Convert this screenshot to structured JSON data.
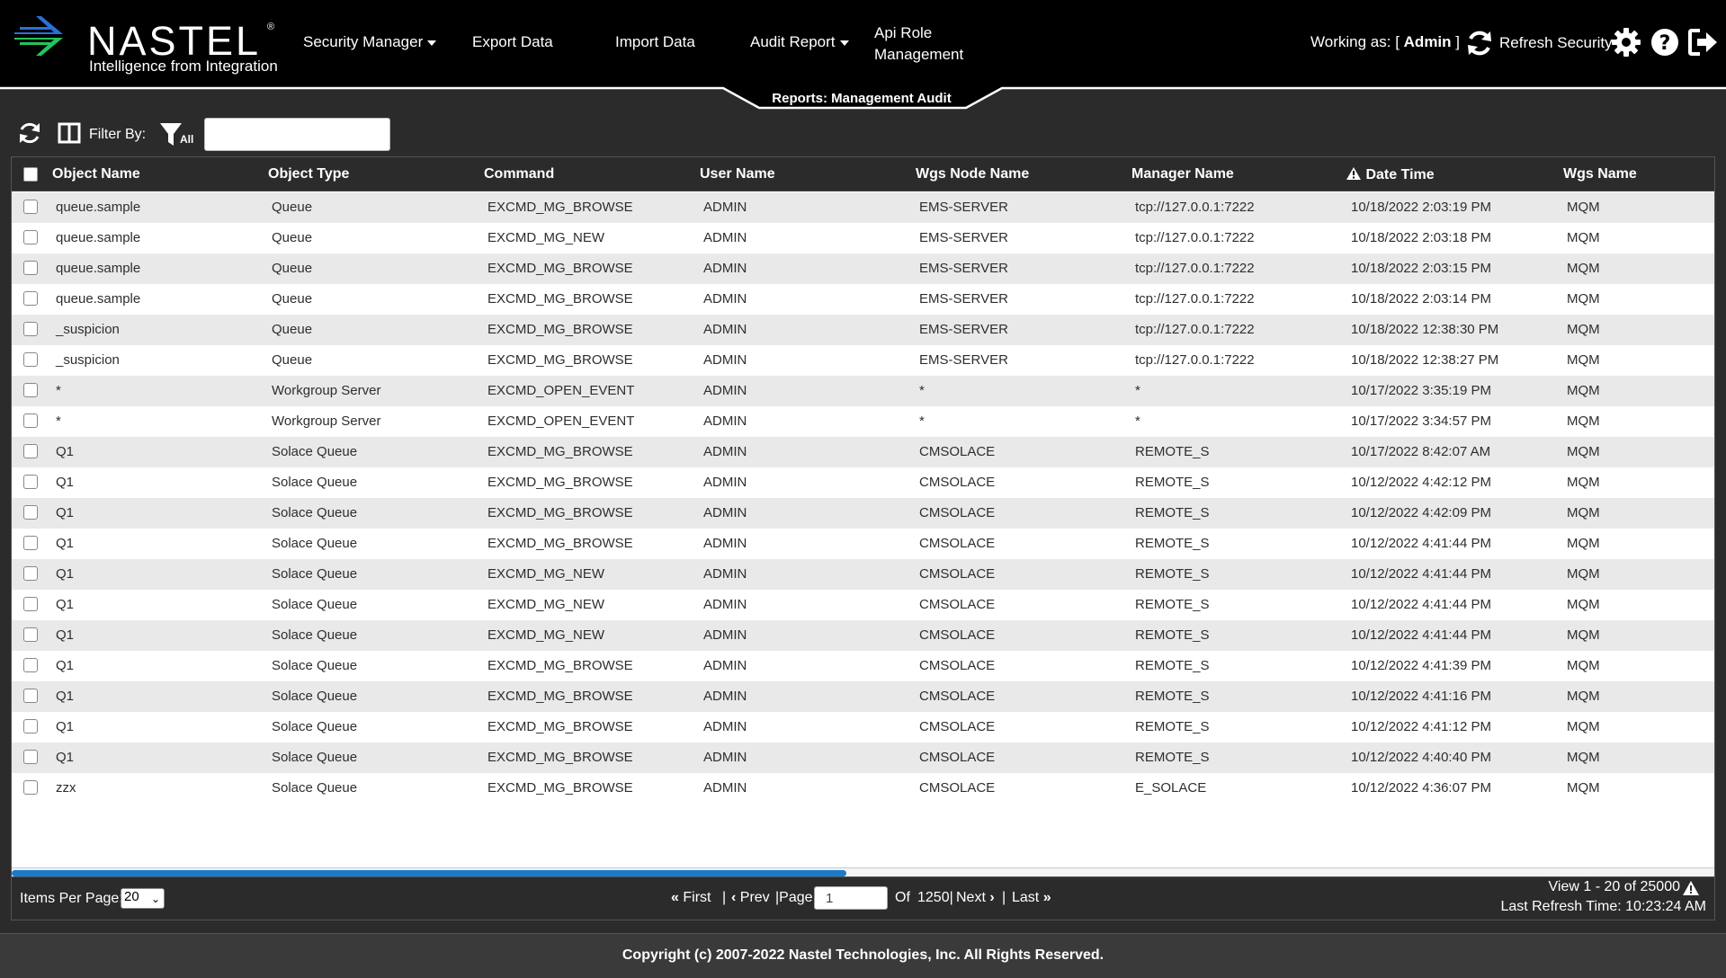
{
  "brand": {
    "logo_text": "NASTEL",
    "registered": "®",
    "tagline": "Intelligence from Integration"
  },
  "nav": {
    "security_manager": "Security Manager",
    "export_data": "Export Data",
    "import_data": "Import Data",
    "audit_report": "Audit Report",
    "api_role_line1": "Api Role",
    "api_role_line2": "Management"
  },
  "user": {
    "working_as_label": "Working as:",
    "bracket_open": "[",
    "name": "Admin",
    "bracket_close": "]",
    "refresh_security": "Refresh Security"
  },
  "icons": {
    "refresh": "refresh-icon",
    "settings": "gear-icon",
    "help": "help-icon",
    "logout": "logout-icon",
    "columns": "columns-icon",
    "filter": "filter-icon",
    "sort": "warning-triangle-icon"
  },
  "page": {
    "tab_title": "Reports: Management Audit"
  },
  "toolbar": {
    "filter_by_label": "Filter By:",
    "filter_all_label": "All",
    "filter_value": ""
  },
  "table": {
    "columns": [
      "Object Name",
      "Object Type",
      "Command",
      "User Name",
      "Wgs Node Name",
      "Manager Name",
      "Date Time",
      "Wgs Name"
    ],
    "rows": [
      [
        "queue.sample",
        "Queue",
        "EXCMD_MG_BROWSE",
        "ADMIN",
        "EMS-SERVER",
        "tcp://127.0.0.1:7222",
        "10/18/2022 2:03:19 PM",
        "MQM"
      ],
      [
        "queue.sample",
        "Queue",
        "EXCMD_MG_NEW",
        "ADMIN",
        "EMS-SERVER",
        "tcp://127.0.0.1:7222",
        "10/18/2022 2:03:18 PM",
        "MQM"
      ],
      [
        "queue.sample",
        "Queue",
        "EXCMD_MG_BROWSE",
        "ADMIN",
        "EMS-SERVER",
        "tcp://127.0.0.1:7222",
        "10/18/2022 2:03:15 PM",
        "MQM"
      ],
      [
        "queue.sample",
        "Queue",
        "EXCMD_MG_BROWSE",
        "ADMIN",
        "EMS-SERVER",
        "tcp://127.0.0.1:7222",
        "10/18/2022 2:03:14 PM",
        "MQM"
      ],
      [
        "_suspicion",
        "Queue",
        "EXCMD_MG_BROWSE",
        "ADMIN",
        "EMS-SERVER",
        "tcp://127.0.0.1:7222",
        "10/18/2022 12:38:30 PM",
        "MQM"
      ],
      [
        "_suspicion",
        "Queue",
        "EXCMD_MG_BROWSE",
        "ADMIN",
        "EMS-SERVER",
        "tcp://127.0.0.1:7222",
        "10/18/2022 12:38:27 PM",
        "MQM"
      ],
      [
        "*",
        "Workgroup Server",
        "EXCMD_OPEN_EVENT",
        "ADMIN",
        "*",
        "*",
        "10/17/2022 3:35:19 PM",
        "MQM"
      ],
      [
        "*",
        "Workgroup Server",
        "EXCMD_OPEN_EVENT",
        "ADMIN",
        "*",
        "*",
        "10/17/2022 3:34:57 PM",
        "MQM"
      ],
      [
        "Q1",
        "Solace Queue",
        "EXCMD_MG_BROWSE",
        "ADMIN",
        "CMSOLACE",
        "REMOTE_S",
        "10/17/2022 8:42:07 AM",
        "MQM"
      ],
      [
        "Q1",
        "Solace Queue",
        "EXCMD_MG_BROWSE",
        "ADMIN",
        "CMSOLACE",
        "REMOTE_S",
        "10/12/2022 4:42:12 PM",
        "MQM"
      ],
      [
        "Q1",
        "Solace Queue",
        "EXCMD_MG_BROWSE",
        "ADMIN",
        "CMSOLACE",
        "REMOTE_S",
        "10/12/2022 4:42:09 PM",
        "MQM"
      ],
      [
        "Q1",
        "Solace Queue",
        "EXCMD_MG_BROWSE",
        "ADMIN",
        "CMSOLACE",
        "REMOTE_S",
        "10/12/2022 4:41:44 PM",
        "MQM"
      ],
      [
        "Q1",
        "Solace Queue",
        "EXCMD_MG_NEW",
        "ADMIN",
        "CMSOLACE",
        "REMOTE_S",
        "10/12/2022 4:41:44 PM",
        "MQM"
      ],
      [
        "Q1",
        "Solace Queue",
        "EXCMD_MG_NEW",
        "ADMIN",
        "CMSOLACE",
        "REMOTE_S",
        "10/12/2022 4:41:44 PM",
        "MQM"
      ],
      [
        "Q1",
        "Solace Queue",
        "EXCMD_MG_NEW",
        "ADMIN",
        "CMSOLACE",
        "REMOTE_S",
        "10/12/2022 4:41:44 PM",
        "MQM"
      ],
      [
        "Q1",
        "Solace Queue",
        "EXCMD_MG_BROWSE",
        "ADMIN",
        "CMSOLACE",
        "REMOTE_S",
        "10/12/2022 4:41:39 PM",
        "MQM"
      ],
      [
        "Q1",
        "Solace Queue",
        "EXCMD_MG_BROWSE",
        "ADMIN",
        "CMSOLACE",
        "REMOTE_S",
        "10/12/2022 4:41:16 PM",
        "MQM"
      ],
      [
        "Q1",
        "Solace Queue",
        "EXCMD_MG_BROWSE",
        "ADMIN",
        "CMSOLACE",
        "REMOTE_S",
        "10/12/2022 4:41:12 PM",
        "MQM"
      ],
      [
        "Q1",
        "Solace Queue",
        "EXCMD_MG_BROWSE",
        "ADMIN",
        "CMSOLACE",
        "REMOTE_S",
        "10/12/2022 4:40:40 PM",
        "MQM"
      ],
      [
        "zzx",
        "Solace Queue",
        "EXCMD_MG_BROWSE",
        "ADMIN",
        "CMSOLACE",
        "E_SOLACE",
        "10/12/2022 4:36:07 PM",
        "MQM"
      ]
    ],
    "horizontal_scroll_fraction": 0.49
  },
  "pagination": {
    "items_per_page_label": "Items Per Page:",
    "items_per_page": "20",
    "first": "First",
    "sep1": "|",
    "prev": "Prev",
    "page_label": "|Page",
    "page_value": "1",
    "of_label": "Of",
    "total_pages": "1250|",
    "next": "Next",
    "sep2": "|",
    "last": "Last",
    "view_range": "View  1 - 20  of  25000",
    "last_refresh": "Last Refresh Time:  10:23:24 AM"
  },
  "footer": {
    "copyright": "Copyright (c) 2007-2022 Nastel Technologies, Inc. All Rights Reserved."
  },
  "colors": {
    "header_bg": "#000000",
    "panel_bg": "#2b2b2b",
    "row_alt": "#e9e9e9",
    "scroll_thumb": "#1a7ac9",
    "logo_blue": "#2a6fdb",
    "logo_green": "#22c55e"
  }
}
